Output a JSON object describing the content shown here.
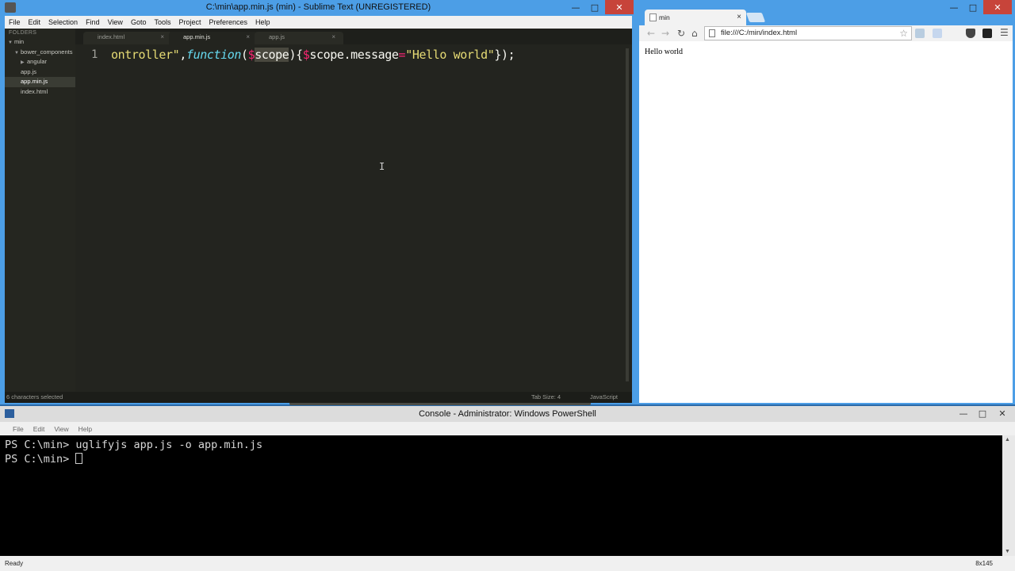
{
  "sublime": {
    "title": "C:\\min\\app.min.js (min) - Sublime Text (UNREGISTERED)",
    "menu": [
      "File",
      "Edit",
      "Selection",
      "Find",
      "View",
      "Goto",
      "Tools",
      "Project",
      "Preferences",
      "Help"
    ],
    "sidebar": {
      "heading": "FOLDERS",
      "items": [
        {
          "label": "min",
          "depth": 0,
          "arrow": "▼"
        },
        {
          "label": "bower_components",
          "depth": 1,
          "arrow": "▼"
        },
        {
          "label": "angular",
          "depth": 2,
          "arrow": "▶"
        },
        {
          "label": "app.js",
          "depth": 1,
          "arrow": ""
        },
        {
          "label": "app.min.js",
          "depth": 1,
          "arrow": ""
        },
        {
          "label": "index.html",
          "depth": 1,
          "arrow": ""
        }
      ],
      "selected_index": 4
    },
    "tabs": [
      {
        "label": "index.html",
        "close": "×"
      },
      {
        "label": "app.min.js",
        "close": "×"
      },
      {
        "label": "app.js",
        "close": "×"
      }
    ],
    "active_tab": 1,
    "line_number": "1",
    "code_tokens": [
      {
        "text": "ontroller\"",
        "kind": "str"
      },
      {
        "text": ",",
        "kind": "plain"
      },
      {
        "text": "function",
        "kind": "fn"
      },
      {
        "text": "(",
        "kind": "plain"
      },
      {
        "text": "$",
        "kind": "var"
      },
      {
        "text": "scope",
        "kind": "sel"
      },
      {
        "text": "){",
        "kind": "plain"
      },
      {
        "text": "$",
        "kind": "var"
      },
      {
        "text": "scope.message",
        "kind": "plain"
      },
      {
        "text": "=",
        "kind": "op"
      },
      {
        "text": "\"Hello world\"",
        "kind": "str"
      },
      {
        "text": "});",
        "kind": "plain"
      }
    ],
    "status": {
      "selection": "6 characters selected",
      "tab_size": "Tab Size: 4",
      "syntax": "JavaScript"
    },
    "window_buttons": {
      "min": "—",
      "max": "□",
      "close": "✕"
    }
  },
  "chrome": {
    "tab_title": "min",
    "tab_close": "×",
    "url": "file:///C:/min/index.html",
    "nav": {
      "back": "←",
      "forward": "→",
      "reload": "↻",
      "home": "⌂"
    },
    "star_icon": "☆",
    "menu_icon": "☰",
    "page_text": "Hello world",
    "window_buttons": {
      "min": "—",
      "max": "□",
      "close": "✕"
    }
  },
  "powershell": {
    "title": "Console - Administrator: Windows PowerShell",
    "menu": [
      "File",
      "Edit",
      "View",
      "Help"
    ],
    "lines": [
      "PS C:\\min> uglifyjs app.js -o app.min.js",
      "PS C:\\min> "
    ],
    "status_left": "Ready",
    "status_right": "8x145",
    "window_buttons": {
      "min": "—",
      "max": "□",
      "close": "✕"
    },
    "scroll_up": "▲",
    "scroll_down": "▼"
  }
}
